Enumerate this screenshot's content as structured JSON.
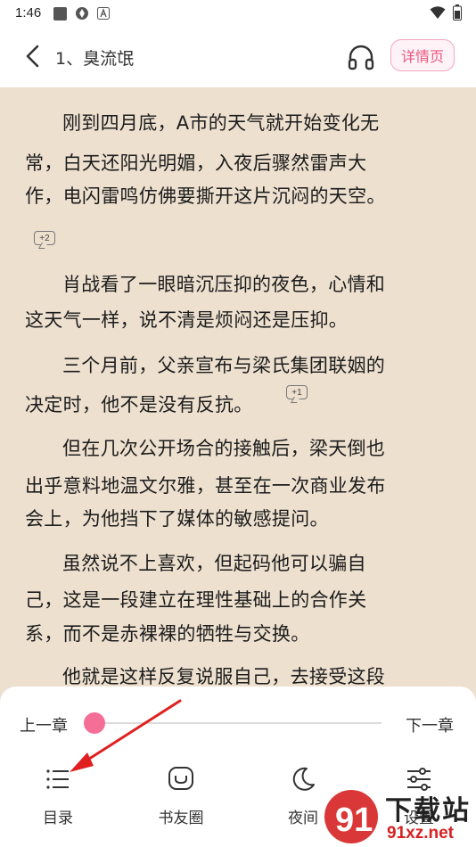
{
  "status_bar": {
    "time": "1:46"
  },
  "header": {
    "title": "1、臭流氓",
    "detail_label": "详情页"
  },
  "content": {
    "lines": [
      "刚到四月底，A市的天气就开始变化无",
      "常，白天还阳光明媚，入夜后骤然雷声大",
      "作，电闪雷鸣仿佛要撕开这片沉闷的天空。",
      "肖战看了一眼暗沉压抑的夜色，心情和",
      "这天气一样，说不清是烦闷还是压抑。",
      "三个月前，父亲宣布与梁氏集团联姻的",
      "决定时，他不是没有反抗。",
      "但在几次公开场合的接触后，梁天倒也",
      "出乎意料地温文尔雅，甚至在一次商业发布",
      "会上，为他挡下了媒体的敏感提问。",
      "虽然说不上喜欢，但起码他可以骗自",
      "己，这是一段建立在理性基础上的合作关",
      "系，而不是赤裸裸的牺牲与交换。",
      "他就是这样反复说服自己，去接受这段"
    ],
    "comment_badges": [
      "+2",
      "+1"
    ]
  },
  "bottom_panel": {
    "prev_label": "上一章",
    "next_label": "下一章",
    "progress": 0.0,
    "nav": [
      {
        "label": "目录",
        "icon": "list-icon"
      },
      {
        "label": "书友圈",
        "icon": "chat-bubble-icon"
      },
      {
        "label": "夜间",
        "icon": "moon-icon"
      },
      {
        "label": "设置",
        "icon": "sliders-icon"
      }
    ]
  },
  "watermark": {
    "text_top": "下载站",
    "text_bottom": "91xz.net"
  },
  "colors": {
    "reader_bg": "#ede0cf",
    "accent": "#f56e96",
    "annotation_arrow": "#e02020"
  }
}
